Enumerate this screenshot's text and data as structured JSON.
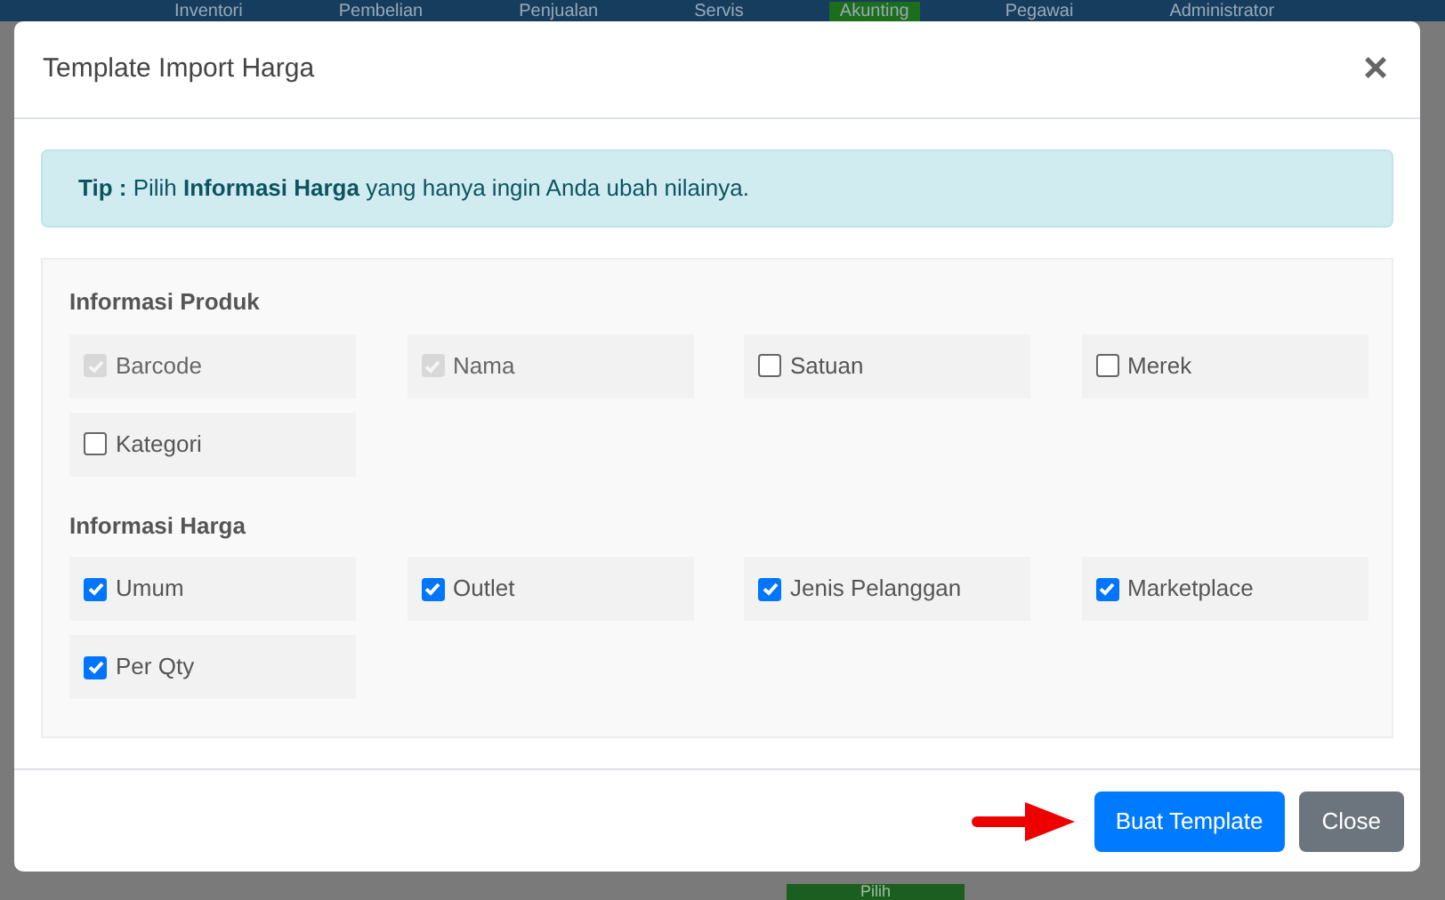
{
  "nav": [
    {
      "label": "Inventori",
      "selected": false
    },
    {
      "label": "Pembelian",
      "selected": false
    },
    {
      "label": "Penjualan",
      "selected": false
    },
    {
      "label": "Servis",
      "selected": false
    },
    {
      "label": "Akunting",
      "selected": true
    },
    {
      "label": "Pegawai",
      "selected": false
    },
    {
      "label": "Administrator",
      "selected": false
    }
  ],
  "background_button": "Pilih",
  "modal": {
    "title": "Template Import Harga",
    "close_symbol": "×",
    "tip": "**Tip :** Pilih **Informasi Harga** yang hanya ingin Anda ubah nilainya.",
    "groups": [
      {
        "title": "Informasi Produk",
        "options": [
          {
            "label": "Barcode",
            "checked": true,
            "disabled": true
          },
          {
            "label": "Nama",
            "checked": true,
            "disabled": true
          },
          {
            "label": "Satuan",
            "checked": false,
            "disabled": false
          },
          {
            "label": "Merek",
            "checked": false,
            "disabled": false
          },
          {
            "label": "Kategori",
            "checked": false,
            "disabled": false
          }
        ]
      },
      {
        "title": "Informasi Harga",
        "options": [
          {
            "label": "Umum",
            "checked": true,
            "disabled": false
          },
          {
            "label": "Outlet",
            "checked": true,
            "disabled": false
          },
          {
            "label": "Jenis Pelanggan",
            "checked": true,
            "disabled": false
          },
          {
            "label": "Marketplace",
            "checked": true,
            "disabled": false
          },
          {
            "label": "Per Qty",
            "checked": true,
            "disabled": false
          }
        ]
      }
    ],
    "buttons": [
      {
        "label": "Buat Template",
        "kind": "primary"
      },
      {
        "label": "Close",
        "kind": "secondary"
      }
    ]
  }
}
